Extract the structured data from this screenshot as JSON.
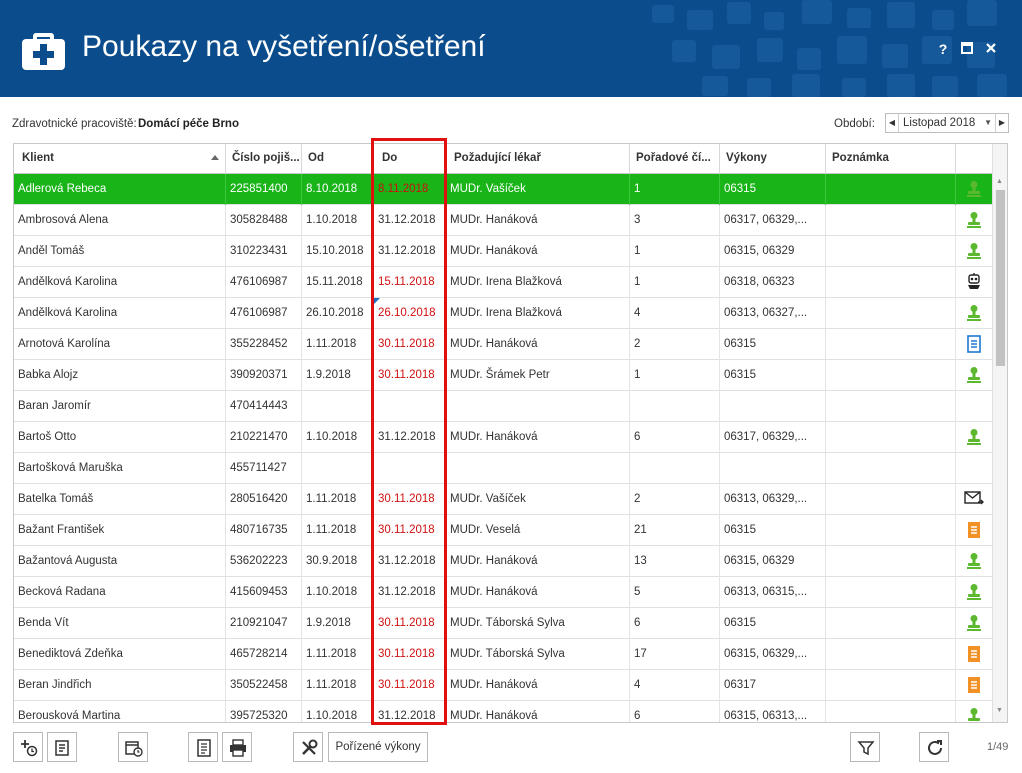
{
  "app": {
    "title": "Poukazy na vyšetření/ošetření",
    "window_buttons": [
      "?",
      "□",
      "×"
    ]
  },
  "info": {
    "workplace_label": "Zdravotnické pracoviště:",
    "workplace_value": "Domácí péče Brno",
    "period_label": "Období:",
    "period_value": "Listopad 2018"
  },
  "table": {
    "columns": [
      "Klient",
      "Číslo pojiš...",
      "Od",
      "Do",
      "Požadující lékař",
      "Pořadové čí...",
      "Výkony",
      "Poznámka",
      ""
    ],
    "rows": [
      {
        "klient": "Adlerová Rebeca",
        "cislo": "225851400",
        "od": "8.10.2018",
        "do": "8.11.2018",
        "do_red": true,
        "lekar": "MUDr. Vašíček",
        "poradi": "1",
        "vykony": "06315",
        "poznamka": "",
        "icon": "person-stamp-icon",
        "selected": true
      },
      {
        "klient": "Ambrosová Alena",
        "cislo": "305828488",
        "od": "1.10.2018",
        "do": "31.12.2018",
        "do_red": false,
        "lekar": "MUDr. Hanáková",
        "poradi": "3",
        "vykony": "06317, 06329,...",
        "poznamka": "",
        "icon": "person-stamp-icon"
      },
      {
        "klient": "Anděl Tomáš",
        "cislo": "310223431",
        "od": "15.10.2018",
        "do": "31.12.2018",
        "do_red": false,
        "lekar": "MUDr. Hanáková",
        "poradi": "1",
        "vykony": "06315, 06329",
        "poznamka": "",
        "icon": "person-stamp-icon"
      },
      {
        "klient": "Andělková Karolina",
        "cislo": "476106987",
        "od": "15.11.2018",
        "do": "15.11.2018",
        "do_red": true,
        "lekar": "MUDr. Irena Blažková",
        "poradi": "1",
        "vykony": "06318, 06323",
        "poznamka": "",
        "icon": "robot-icon"
      },
      {
        "klient": "Andělková Karolina",
        "cislo": "476106987",
        "od": "26.10.2018",
        "do": "26.10.2018",
        "do_red": true,
        "lekar": "MUDr. Irena Blažková",
        "poradi": "4",
        "vykony": "06313, 06327,...",
        "poznamka": "",
        "icon": "person-stamp-icon",
        "note_mark": true
      },
      {
        "klient": "Arnotová Karolína",
        "cislo": "355228452",
        "od": "1.11.2018",
        "do": "30.11.2018",
        "do_red": true,
        "lekar": "MUDr. Hanáková",
        "poradi": "2",
        "vykony": "06315",
        "poznamka": "",
        "icon": "blue-document-icon"
      },
      {
        "klient": "Babka Alojz",
        "cislo": "390920371",
        "od": "1.9.2018",
        "do": "30.11.2018",
        "do_red": true,
        "lekar": "MUDr. Šrámek Petr",
        "poradi": "1",
        "vykony": "06315",
        "poznamka": "",
        "icon": "person-stamp-icon"
      },
      {
        "klient": "Baran Jaromír",
        "cislo": "470414443",
        "od": "",
        "do": "",
        "do_red": false,
        "lekar": "",
        "poradi": "",
        "vykony": "",
        "poznamka": "",
        "icon": ""
      },
      {
        "klient": "Bartoš Otto",
        "cislo": "210221470",
        "od": "1.10.2018",
        "do": "31.12.2018",
        "do_red": false,
        "lekar": "MUDr. Hanáková",
        "poradi": "6",
        "vykony": "06317, 06329,...",
        "poznamka": "",
        "icon": "person-stamp-icon"
      },
      {
        "klient": "Bartošková Maruška",
        "cislo": "455711427",
        "od": "",
        "do": "",
        "do_red": false,
        "lekar": "",
        "poradi": "",
        "vykony": "",
        "poznamka": "",
        "icon": ""
      },
      {
        "klient": "Batelka Tomáš",
        "cislo": "280516420",
        "od": "1.11.2018",
        "do": "30.11.2018",
        "do_red": true,
        "lekar": "MUDr. Vašíček",
        "poradi": "2",
        "vykony": "06313, 06329,...",
        "poznamka": "",
        "icon": "envelope-icon"
      },
      {
        "klient": "Bažant František",
        "cislo": "480716735",
        "od": "1.11.2018",
        "do": "30.11.2018",
        "do_red": true,
        "lekar": "MUDr. Veselá",
        "poradi": "21",
        "vykony": "06315",
        "poznamka": "",
        "icon": "orange-document-icon"
      },
      {
        "klient": "Bažantová Augusta",
        "cislo": "536202223",
        "od": "30.9.2018",
        "do": "31.12.2018",
        "do_red": false,
        "lekar": "MUDr. Hanáková",
        "poradi": "13",
        "vykony": "06315, 06329",
        "poznamka": "",
        "icon": "person-stamp-icon"
      },
      {
        "klient": "Becková Radana",
        "cislo": "415609453",
        "od": "1.10.2018",
        "do": "31.12.2018",
        "do_red": false,
        "lekar": "MUDr. Hanáková",
        "poradi": "5",
        "vykony": "06313, 06315,...",
        "poznamka": "",
        "icon": "person-stamp-icon"
      },
      {
        "klient": "Benda Vít",
        "cislo": "210921047",
        "od": "1.9.2018",
        "do": "30.11.2018",
        "do_red": true,
        "lekar": "MUDr. Táborská Sylva",
        "poradi": "6",
        "vykony": "06315",
        "poznamka": "",
        "icon": "person-stamp-icon"
      },
      {
        "klient": "Benediktová Zdeňka",
        "cislo": "465728214",
        "od": "1.11.2018",
        "do": "30.11.2018",
        "do_red": true,
        "lekar": "MUDr. Táborská Sylva",
        "poradi": "17",
        "vykony": "06315, 06329,...",
        "poznamka": "",
        "icon": "orange-document-icon"
      },
      {
        "klient": "Beran Jindřich",
        "cislo": "350522458",
        "od": "1.11.2018",
        "do": "30.11.2018",
        "do_red": true,
        "lekar": "MUDr. Hanáková",
        "poradi": "4",
        "vykony": "06317",
        "poznamka": "",
        "icon": "orange-document-icon"
      },
      {
        "klient": "Berousková Martina",
        "cislo": "395725320",
        "od": "1.10.2018",
        "do": "31.12.2018",
        "do_red": false,
        "lekar": "MUDr. Hanáková",
        "poradi": "6",
        "vykony": "06315, 06313,...",
        "poznamka": "",
        "icon": "person-stamp-icon"
      }
    ]
  },
  "toolbar": {
    "buttons": [
      "add-timed-icon",
      "list-edit-icon",
      "calendar-clock-icon",
      "document-icon",
      "print-icon",
      "tools-icon"
    ],
    "text_button": "Pořízené výkony",
    "filter_icon": "filter-icon",
    "refresh_icon": "refresh-icon",
    "pager": "1/49"
  },
  "colors": {
    "header": "#0b4d8c",
    "selected_row": "#18b418",
    "date_red": "#d01010",
    "highlight": "#e01010"
  }
}
